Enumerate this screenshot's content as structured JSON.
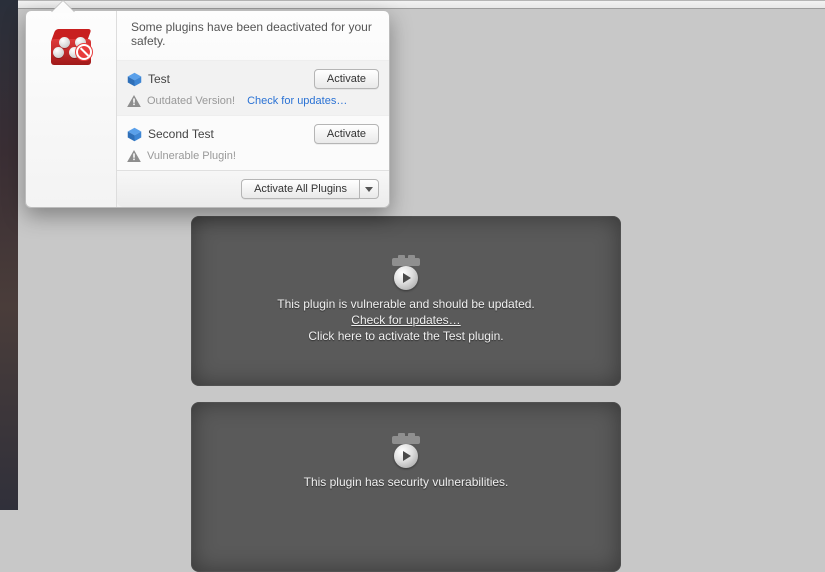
{
  "popover": {
    "message": "Some plugins have been deactivated for your safety.",
    "plugins": [
      {
        "name": "Test",
        "activate_label": "Activate",
        "status": "Outdated Version!",
        "link": "Check for updates…"
      },
      {
        "name": "Second Test",
        "activate_label": "Activate",
        "status": "Vulnerable Plugin!",
        "link": ""
      }
    ],
    "activate_all_label": "Activate All Plugins"
  },
  "placeholders": [
    {
      "warning": "This plugin is vulnerable and should be updated.",
      "update_link": "Check for updates…",
      "activate_hint": "Click here to activate the Test plugin."
    },
    {
      "warning": "This plugin has security vulnerabilities."
    }
  ]
}
